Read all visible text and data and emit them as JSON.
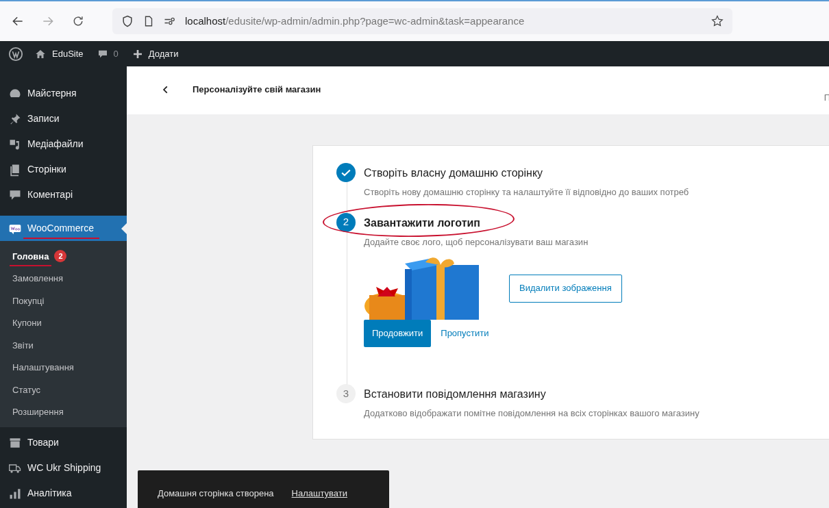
{
  "browser": {
    "url_host": "localhost",
    "url_path": "/edusite/wp-admin/admin.php?page=wc-admin&task=appearance"
  },
  "admin_bar": {
    "site_name": "EduSite",
    "comments_count": "0",
    "add_label": "Додати"
  },
  "sidebar": {
    "items": [
      {
        "label": "Майстерня",
        "selected": false,
        "highlighted": false
      },
      {
        "label": "Записи",
        "selected": false,
        "highlighted": false
      },
      {
        "label": "Медіафайли",
        "selected": false,
        "highlighted": false
      },
      {
        "label": "Сторінки",
        "selected": false,
        "highlighted": false
      },
      {
        "label": "Коментарі",
        "selected": false,
        "highlighted": false
      },
      {
        "label": "WooCommerce",
        "selected": true,
        "highlighted": true,
        "children": [
          {
            "label": "Головна",
            "selected": true,
            "highlighted": true,
            "badge": "2"
          },
          {
            "label": "Замовлення",
            "selected": false,
            "highlighted": false
          },
          {
            "label": "Покупці",
            "selected": false,
            "highlighted": false
          },
          {
            "label": "Купони",
            "selected": false,
            "highlighted": false
          },
          {
            "label": "Звіти",
            "selected": false,
            "highlighted": false
          },
          {
            "label": "Налаштування",
            "selected": false,
            "highlighted": false
          },
          {
            "label": "Статус",
            "selected": false,
            "highlighted": false
          },
          {
            "label": "Розширення",
            "selected": false,
            "highlighted": false
          }
        ]
      },
      {
        "label": "Товари",
        "selected": false,
        "highlighted": false
      },
      {
        "label": "WC Ukr Shipping",
        "selected": false,
        "highlighted": false
      },
      {
        "label": "Аналітика",
        "selected": false,
        "highlighted": false
      }
    ]
  },
  "header": {
    "title": "Персоналізуйте свій магазин",
    "right_cut": "П"
  },
  "steps": [
    {
      "kind": "done",
      "title": "Створіть власну домашню сторінку",
      "description": "Створіть нову домашню сторінку та налаштуйте її відповідно до ваших потреб",
      "highlighted": false
    },
    {
      "kind": "current",
      "number": "2",
      "title": "Завантажити логотип",
      "description": "Додайте своє лого, щоб персоналізувати ваш магазин",
      "highlighted": true,
      "remove_button": "Видалити зображення",
      "primary_button": "Продовжити",
      "skip_link": "Пропустити"
    },
    {
      "kind": "pending",
      "number": "3",
      "title": "Встановити повідомлення магазину",
      "description": "Додатково відображати помітне повідомлення на всіх сторінках вашого магазину",
      "highlighted": false
    }
  ],
  "snackbar": {
    "message": "Домашня сторінка створена",
    "action": "Налаштувати"
  }
}
